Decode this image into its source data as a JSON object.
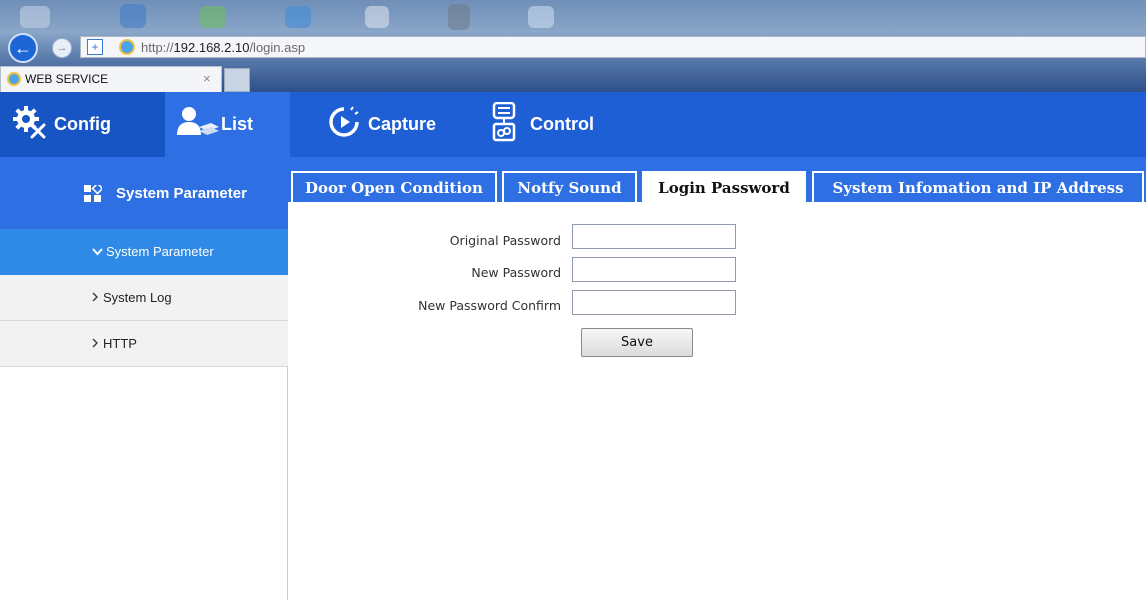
{
  "browser": {
    "url_prefix": "http://",
    "url_host": "192.168.2.10",
    "url_path": "/login.asp",
    "tab_title": "WEB SERVICE",
    "tab_close": "×"
  },
  "header": {
    "menu": [
      {
        "label": "Config",
        "icon": "gear-icon"
      },
      {
        "label": "List",
        "icon": "users-icon"
      },
      {
        "label": "Capture",
        "icon": "capture-icon"
      },
      {
        "label": "Control",
        "icon": "control-icon"
      }
    ]
  },
  "sidebar": {
    "title": "System Parameter",
    "items": [
      {
        "label": "System Parameter",
        "chevron": "chevron-down-icon",
        "active": true
      },
      {
        "label": "System Log",
        "chevron": "chevron-right-icon",
        "active": false
      },
      {
        "label": "HTTP",
        "chevron": "chevron-right-icon",
        "active": false
      }
    ]
  },
  "tabs": [
    {
      "label": "Door Open Condition",
      "active": false
    },
    {
      "label": "Notfy Sound",
      "active": false
    },
    {
      "label": "Login Password",
      "active": true
    },
    {
      "label": "System Infomation and IP Address",
      "active": false
    }
  ],
  "form": {
    "original_password_label": "Original Password",
    "new_password_label": "New Password",
    "new_password_confirm_label": "New Password Confirm",
    "original_password_value": "",
    "new_password_value": "",
    "new_password_confirm_value": "",
    "save_label": "Save"
  },
  "colors": {
    "header_blue": "#1f5fd6",
    "tab_blue": "#2e6fe4",
    "active_item_blue": "#2e8ae6"
  }
}
